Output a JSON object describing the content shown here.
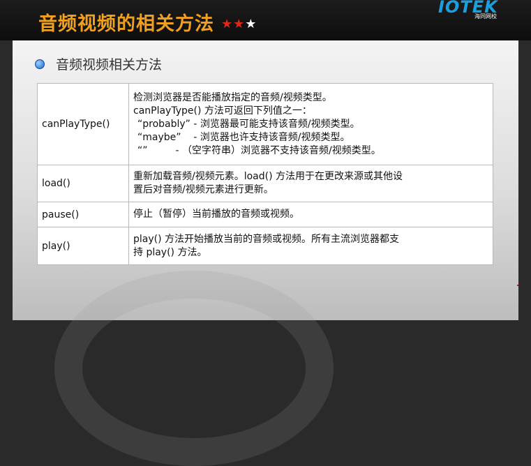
{
  "header": {
    "title": "音频视频的相关方法",
    "stars": [
      "★",
      "★",
      "★"
    ],
    "rating": 2,
    "logo": "IOTEK",
    "logo_sub": "海同网校"
  },
  "slide": {
    "subtitle": "音频视频相关方法"
  },
  "methods": [
    {
      "name": "canPlayType()",
      "lines": [
        "检测浏览器是否能播放指定的音频/视频类型。",
        "canPlayType() 方法可返回下列值之一：",
        "“probably” - 浏览器最可能支持该音频/视频类型。",
        "“maybe”    - 浏览器也许支持该音频/视频类型。",
        "“”         - （空字符串）浏览器不支持该音频/视频类型。"
      ]
    },
    {
      "name": "load()",
      "lines": [
        "重新加载音频/视频元素。load() 方法用于在更改来源或其他设",
        "置后对音频/视频元素进行更新。"
      ]
    },
    {
      "name": "pause()",
      "lines": [
        "停止（暂停）当前播放的音频或视频。"
      ]
    },
    {
      "name": "play()",
      "lines": [
        "play() 方法开始播放当前的音频或视频。所有主流浏览器都支",
        "持 play() 方法。"
      ]
    }
  ],
  "colors": {
    "title": "#f0a020",
    "star_active": "#e02818",
    "star_inactive": "#ffffff",
    "logo": "#1aa0e0"
  }
}
